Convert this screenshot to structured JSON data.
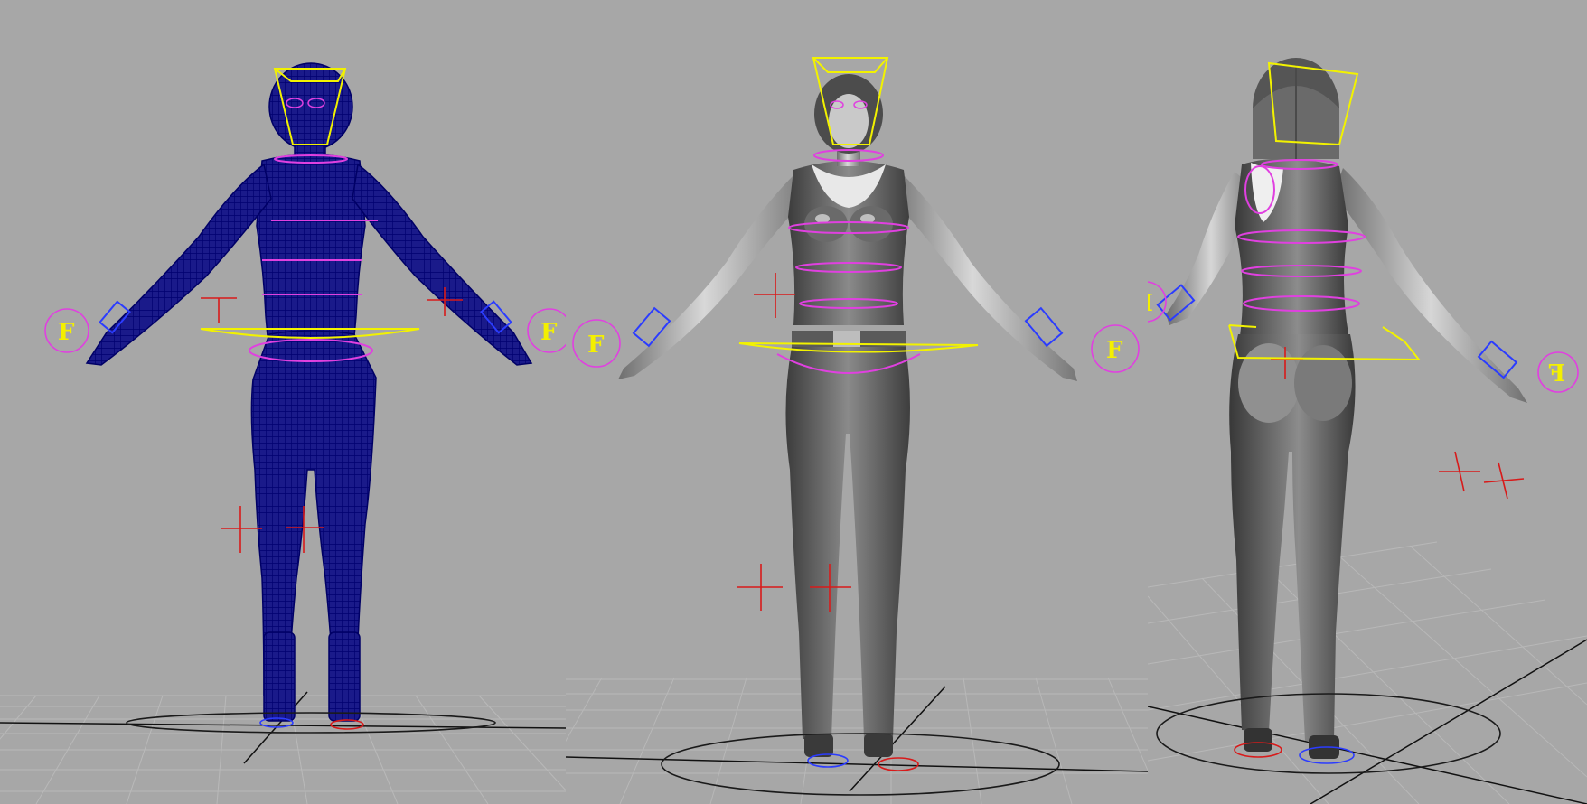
{
  "app": {
    "name": ""
  },
  "viewports": [
    {
      "id": "vp-wire",
      "shading": "wireframe",
      "wire_color": "#000080"
    },
    {
      "id": "vp-front",
      "shading": "smooth"
    },
    {
      "id": "vp-back",
      "shading": "smooth"
    }
  ],
  "controls": {
    "fk_ik_switch_label": "F",
    "fk_ik_switch_label_mirrored": "F"
  },
  "colors": {
    "background": "#a7a7a7",
    "grid": "#b8b8b8",
    "grid_axis": "#1a1a1a",
    "wireframe": "#000080",
    "head_control": "#f2f200",
    "spine_control": "#e040e0",
    "wrist_control": "#2b3cff",
    "pole_vector": "#d81a1a",
    "foot_control_left": "#d81a1a",
    "foot_control_right": "#2b3cff"
  }
}
